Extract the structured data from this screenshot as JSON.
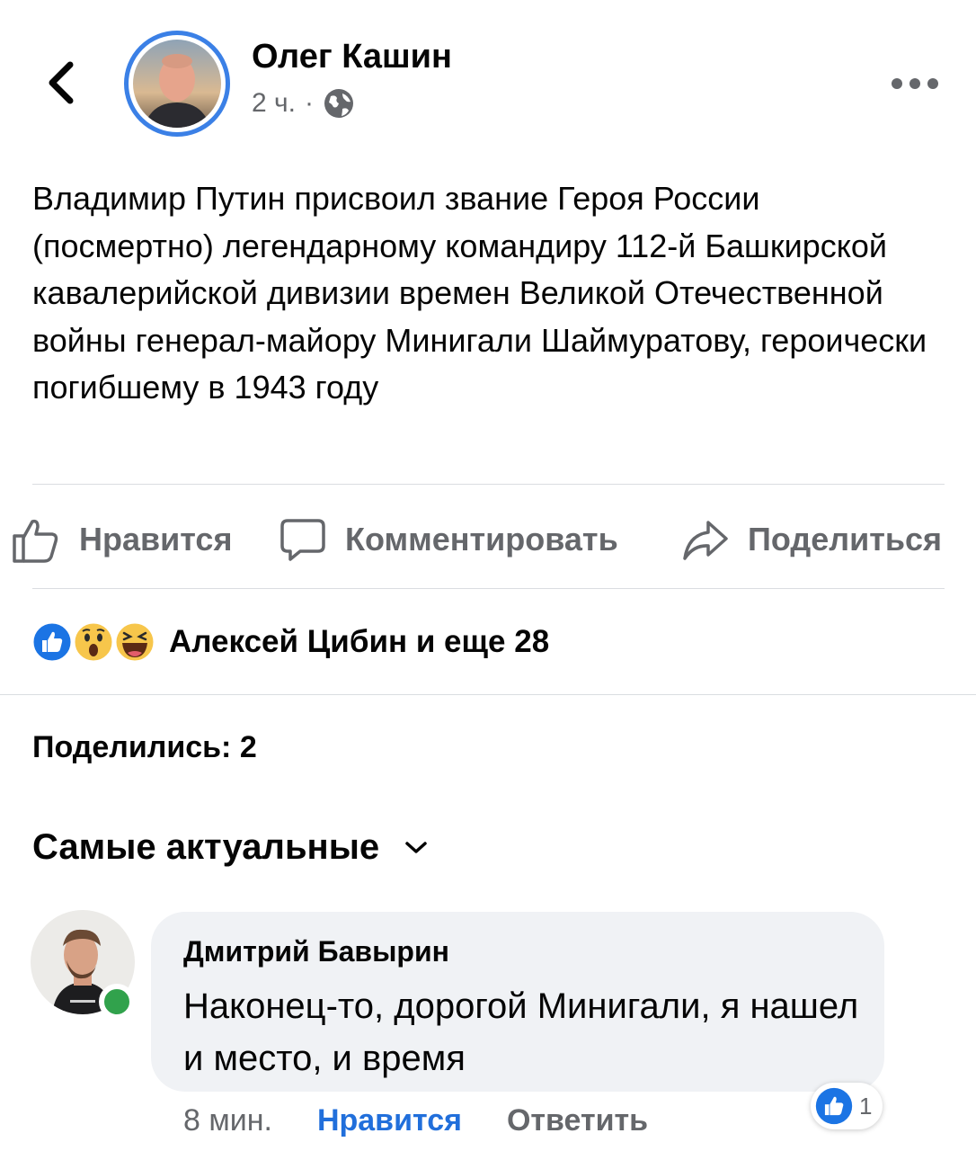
{
  "post": {
    "author": "Олег Кашин",
    "time": "2 ч.",
    "separator": "·",
    "privacy_icon": "globe-icon",
    "text": "Владимир Путин присвоил звание Героя России (посмертно) легендарному командиру 112-й Башкирской кавалерийской дивизии времен Великой Отечественной войны генерал-майору Минигали Шаймуратову, героически погибшему в 1943 году"
  },
  "actions": {
    "like_label": "Нравится",
    "comment_label": "Комментировать",
    "share_label": "Поделиться"
  },
  "reactions": {
    "icons": [
      "like-reaction-icon",
      "wow-reaction-icon",
      "haha-reaction-icon"
    ],
    "summary": "Алексей Цибин и еще 28"
  },
  "shares": {
    "label": "Поделились: 2"
  },
  "comments": {
    "sort_label": "Самые актуальные",
    "items": [
      {
        "author": "Дмитрий Бавырин",
        "text": "Наконец-то, дорогой Минигали, я нашел и место, и время",
        "time": "8 мин.",
        "like_label": "Нравится",
        "reply_label": "Ответить",
        "like_count": "1",
        "online": true
      }
    ]
  },
  "colors": {
    "accent_blue": "#216fdb",
    "avatar_ring": "#3b80e6",
    "secondary_text": "#65676b",
    "bubble_bg": "#f0f2f5",
    "online_green": "#31a24c"
  }
}
